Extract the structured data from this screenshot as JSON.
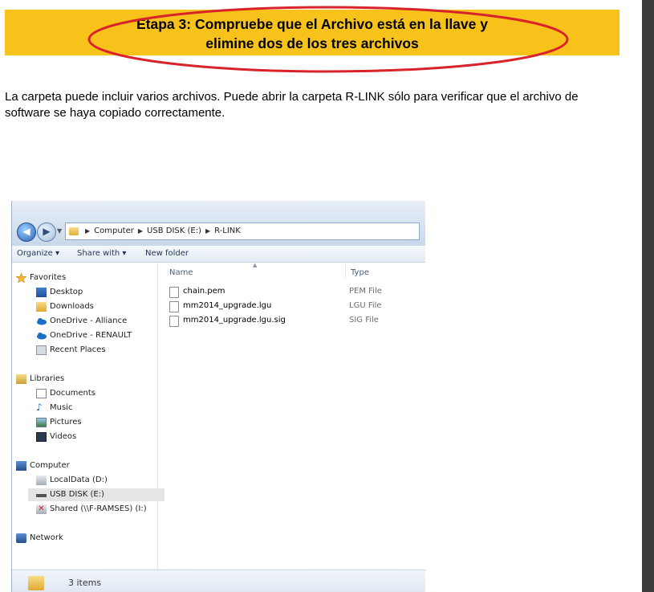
{
  "banner": {
    "line1": "Etapa 3: Compruebe que el Archivo está en la llave y",
    "line2": "elimine dos de los tres archivos",
    "bg_color": "#f7c21a",
    "highlight_color": "#d9232b"
  },
  "intro": {
    "text": "La carpeta puede incluir varios archivos. Puede abrir la carpeta R-LINK sólo para verificar que el archivo de software se haya copiado correctamente."
  },
  "explorer": {
    "breadcrumb": [
      "Computer",
      "USB DISK (E:)",
      "R-LINK"
    ],
    "toolbar": {
      "organize": "Organize ▾",
      "share_with": "Share with ▾",
      "new_folder": "New folder"
    },
    "nav": {
      "favorites": "Favorites",
      "desktop": "Desktop",
      "downloads": "Downloads",
      "onedrive_alliance": "OneDrive - Alliance",
      "onedrive_renault": "OneDrive - RENAULT",
      "recent_places": "Recent Places",
      "libraries": "Libraries",
      "documents": "Documents",
      "music": "Music",
      "pictures": "Pictures",
      "videos": "Videos",
      "computer": "Computer",
      "localdata": "LocalData (D:)",
      "usb_disk": "USB DISK (E:)",
      "shared": "Shared (\\\\F-RAMSES) (I:)",
      "network": "Network"
    },
    "columns": {
      "name": "Name",
      "type": "Type"
    },
    "files": [
      {
        "name": "chain.pem",
        "type": "PEM File"
      },
      {
        "name": "mm2014_upgrade.lgu",
        "type": "LGU File"
      },
      {
        "name": "mm2014_upgrade.lgu.sig",
        "type": "SIG File"
      }
    ],
    "status": "3 items"
  }
}
